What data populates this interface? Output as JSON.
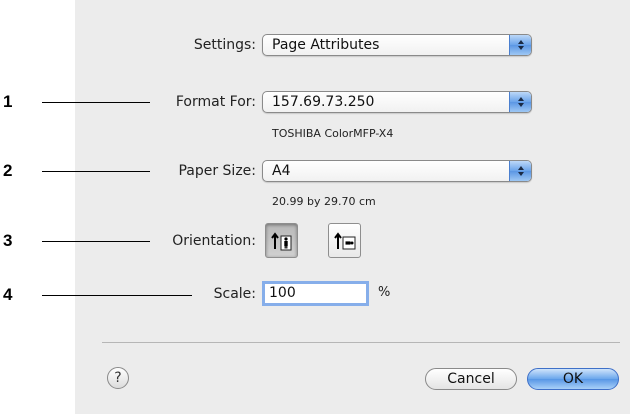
{
  "callouts": [
    "1",
    "2",
    "3",
    "4"
  ],
  "settings": {
    "label": "Settings:",
    "value": "Page Attributes"
  },
  "format_for": {
    "label": "Format For:",
    "value": "157.69.73.250",
    "subtitle": "TOSHIBA ColorMFP-X4"
  },
  "paper_size": {
    "label": "Paper Size:",
    "value": "A4",
    "subtitle": "20.99 by 29.70 cm"
  },
  "orientation": {
    "label": "Orientation:",
    "options": [
      "portrait",
      "landscape"
    ],
    "selected": "portrait"
  },
  "scale": {
    "label": "Scale:",
    "value": "100",
    "unit": "%"
  },
  "buttons": {
    "help": "?",
    "cancel": "Cancel",
    "ok": "OK"
  },
  "colors": {
    "dialog_bg": "#ececec",
    "accent": "#5b96e4",
    "focus_ring": "#86aeea"
  }
}
